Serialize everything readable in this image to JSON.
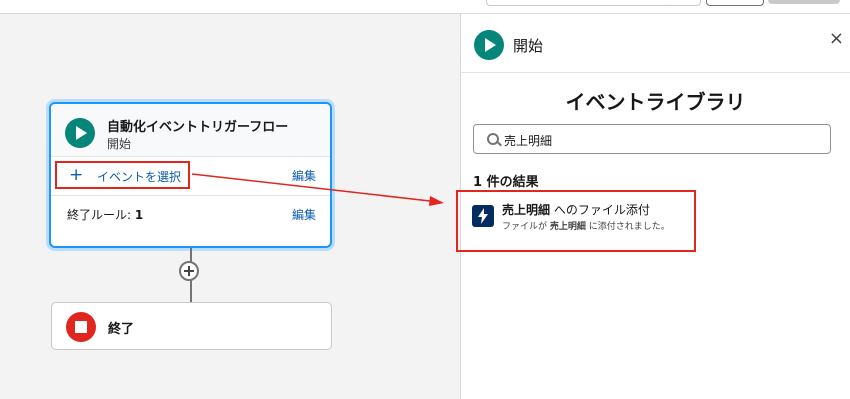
{
  "canvas": {
    "start_node": {
      "title": "自動化イベントトリガーフロー",
      "subtitle": "開始",
      "add_event_label": "イベントを選択",
      "edit_label_1": "編集",
      "end_rule_label": "終了ルール: ",
      "end_rule_value": "1",
      "edit_label_2": "編集"
    },
    "end_node": {
      "label": "終了"
    }
  },
  "panel": {
    "header_title": "開始",
    "close_icon": "×",
    "library_title": "イベントライブラリ",
    "search_value": "売上明細",
    "result_count": "1 件の結果",
    "result": {
      "title_bold": "売上明細",
      "title_rest": " へのファイル添付",
      "desc_prefix": "ファイルが ",
      "desc_bold": "売上明細",
      "desc_suffix": " に添付されました。"
    }
  },
  "colors": {
    "accent": "#0b5cab",
    "start": "#06857a",
    "stop": "#e0261d",
    "highlight": "#e0261d"
  }
}
